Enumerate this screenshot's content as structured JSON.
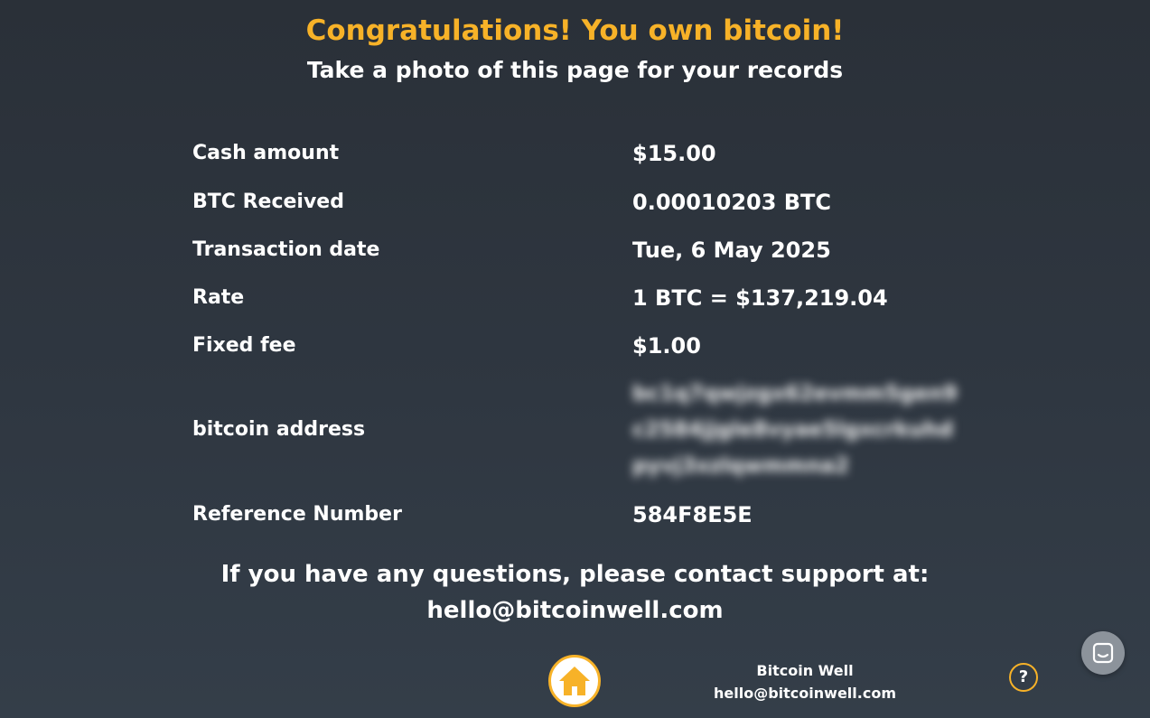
{
  "header": {
    "title": "Congratulations! You own bitcoin!",
    "subtitle": "Take a photo of this page for your records"
  },
  "receipt": {
    "rows": [
      {
        "label": "Cash amount",
        "value": "$15.00"
      },
      {
        "label": "BTC Received",
        "value": "0.00010203 BTC"
      },
      {
        "label": "Transaction date",
        "value": "Tue, 6 May 2025"
      },
      {
        "label": "Rate",
        "value": "1 BTC = $137,219.04"
      },
      {
        "label": "Fixed fee",
        "value": "$1.00"
      },
      {
        "label": "bitcoin address",
        "value": "bc1q7qwjzgx62evmm5gen9c2584jjgle8vyae5lgxcrkuhdpyvj3xzlqwmmna2"
      },
      {
        "label": "Reference Number",
        "value": "584F8E5E"
      }
    ]
  },
  "support": {
    "line1": "If you have any questions, please contact support at:",
    "email": "hello@bitcoinwell.com"
  },
  "footer": {
    "company": "Bitcoin Well",
    "email": "hello@bitcoinwell.com",
    "help_label": "?",
    "home_icon": "home-icon",
    "chat_icon": "chat-icon"
  },
  "colors": {
    "accent": "#f7b228",
    "background": "#2f3741",
    "text": "#ffffff",
    "chat_bubble": "#8c939b"
  }
}
